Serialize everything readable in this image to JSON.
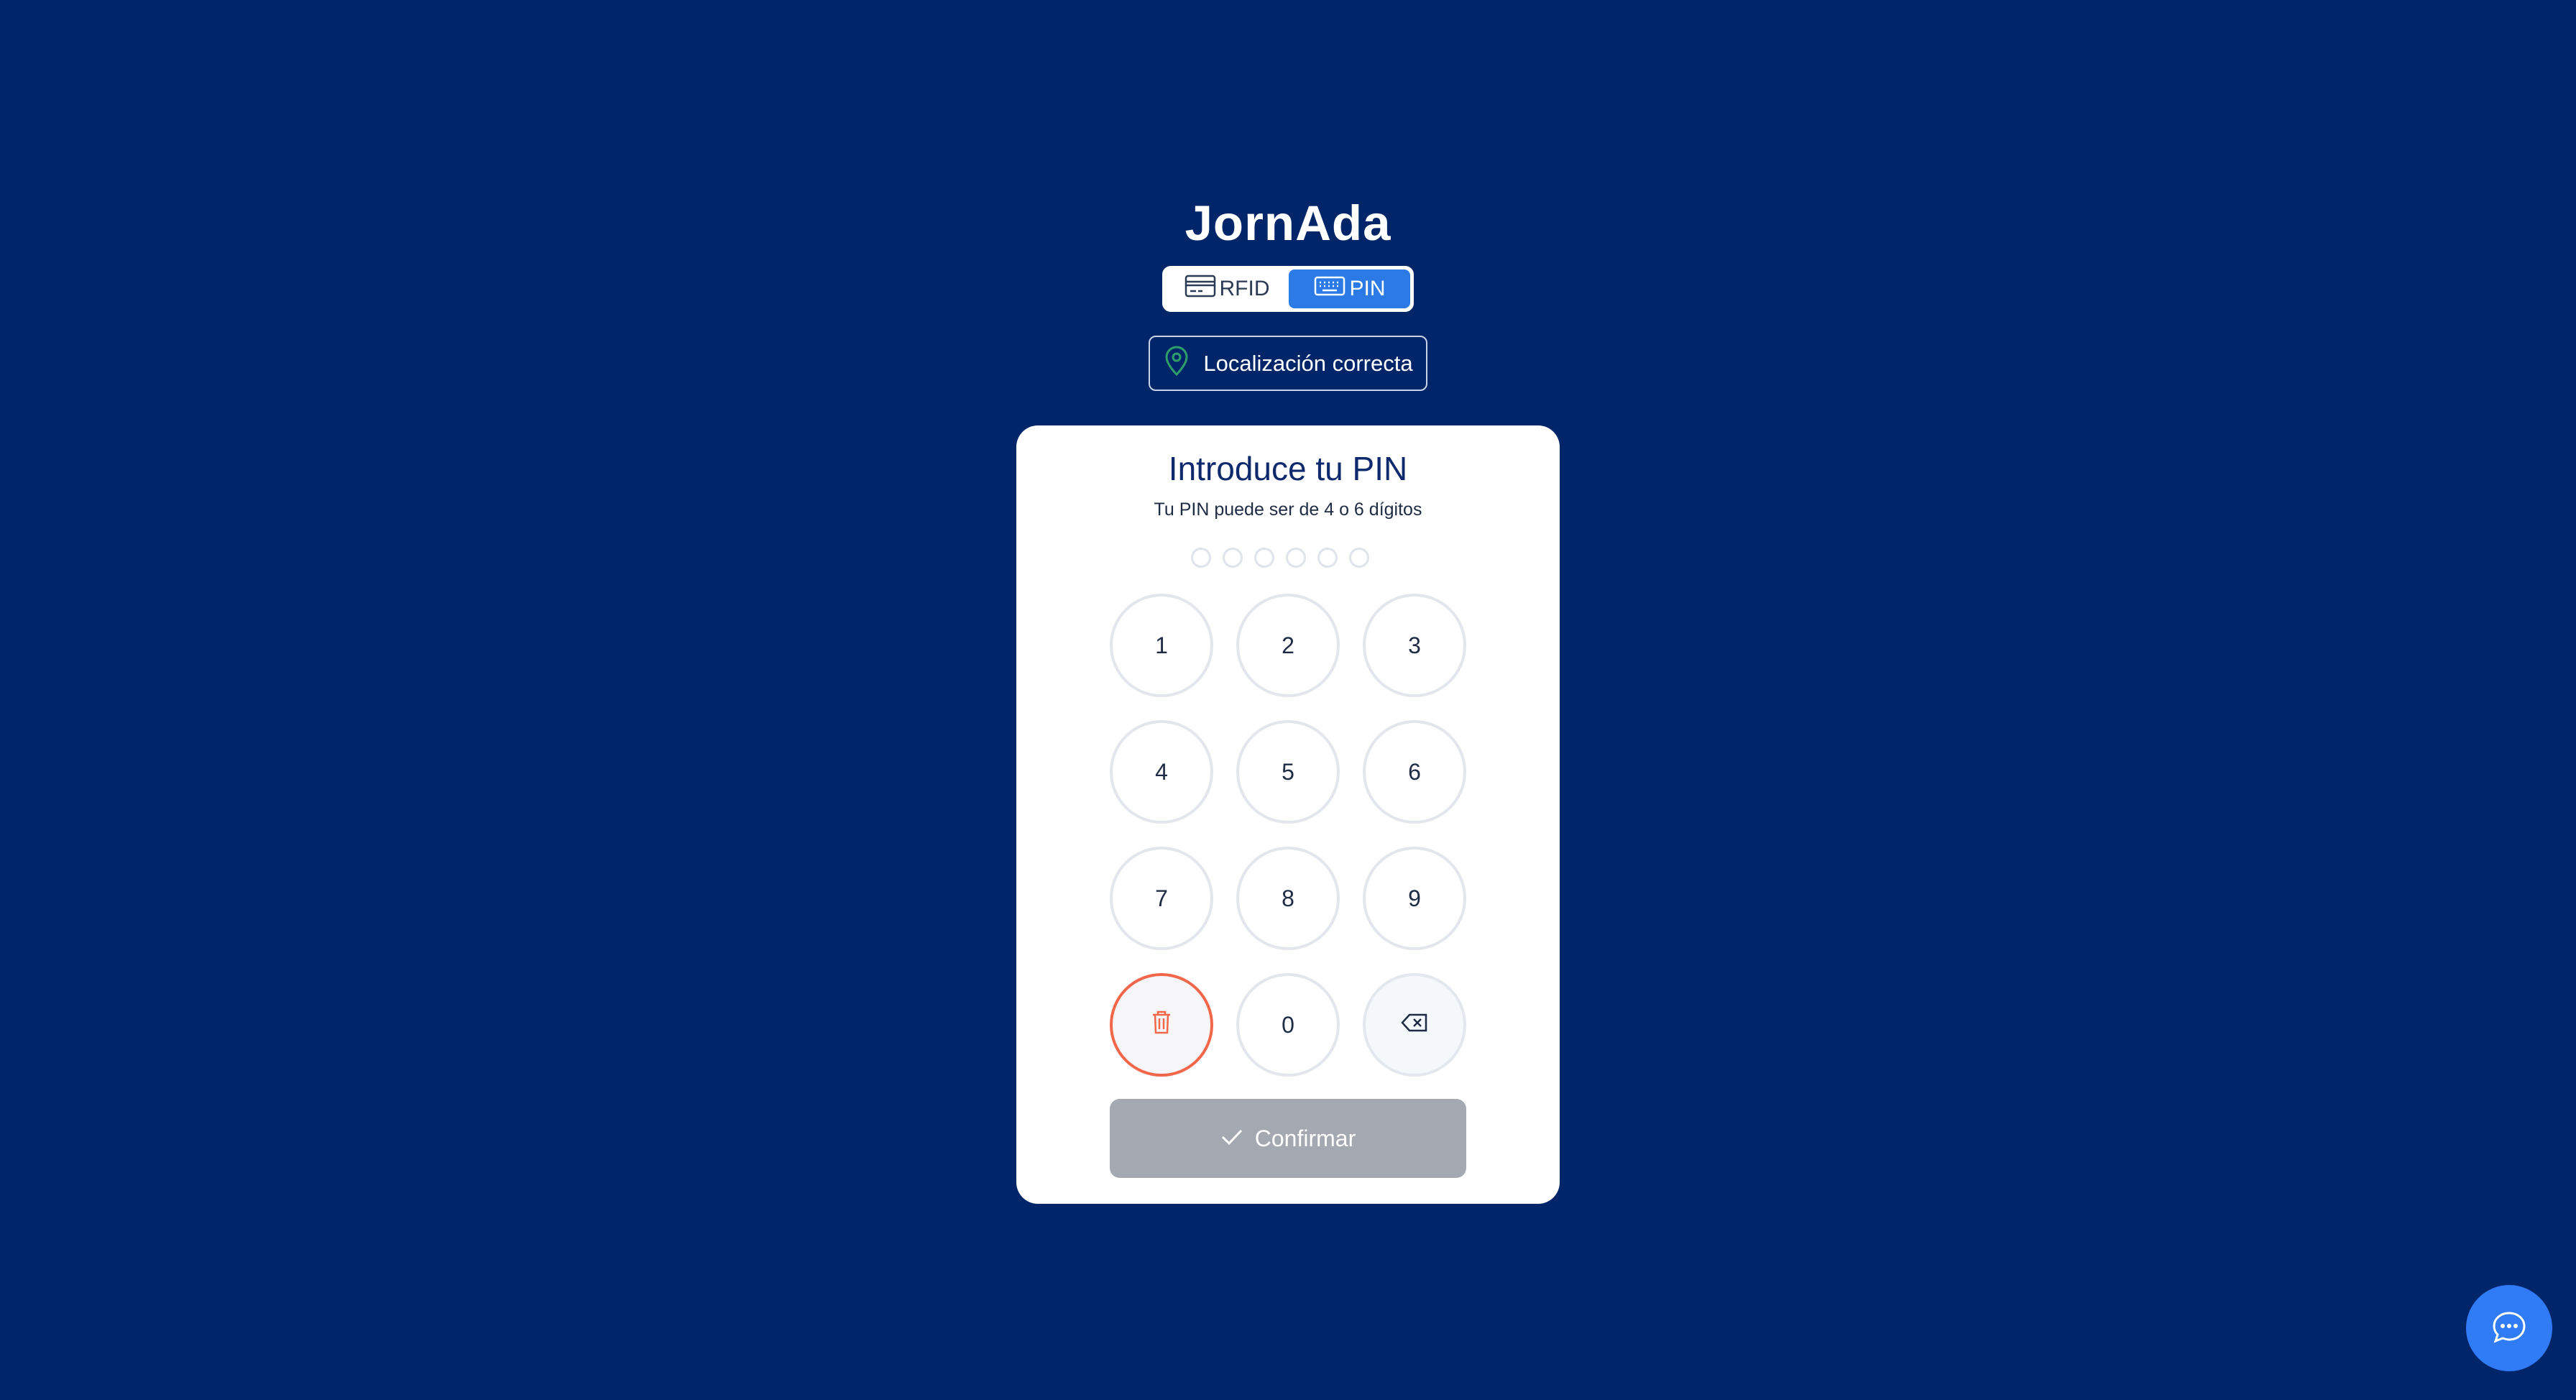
{
  "app": {
    "brand": "JornAda"
  },
  "mode_toggle": {
    "items": [
      {
        "label": "RFID",
        "icon": "card-icon",
        "active": false
      },
      {
        "label": "PIN",
        "icon": "keyboard-icon",
        "active": true
      }
    ]
  },
  "location": {
    "label": "Localización correcta",
    "icon": "map-pin-icon",
    "status_color": "#2e9e6b"
  },
  "pin_card": {
    "title": "Introduce tu PIN",
    "subtitle": "Tu PIN puede ser de 4 o 6 dígitos",
    "pin_length_max": 6,
    "entered_digits": 0,
    "keys": [
      "1",
      "2",
      "3",
      "4",
      "5",
      "6",
      "7",
      "8",
      "9",
      "0"
    ],
    "clear_icon": "trash-icon",
    "backspace_icon": "backspace-icon",
    "confirm_label": "Confirmar",
    "confirm_icon": "check-icon",
    "confirm_enabled": false
  },
  "chat": {
    "icon": "chat-bubble-icon"
  },
  "colors": {
    "background": "#012569",
    "accent": "#2b7ae6",
    "danger": "#f2674a",
    "disabled": "#a4a8b1"
  }
}
